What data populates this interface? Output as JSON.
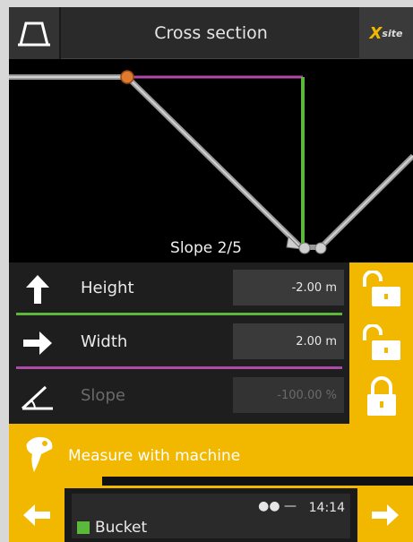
{
  "header": {
    "title": "Cross section",
    "logo_mark": "X",
    "logo_sub": "site",
    "profile_icon": "cross-section-profile-icon"
  },
  "canvas": {
    "slope_label": "Slope 2/5"
  },
  "rows": [
    {
      "label": "Height",
      "value": "-2.00 m",
      "icon": "arrow-up-icon",
      "line_color": "#5cb83b",
      "locked": false
    },
    {
      "label": "Width",
      "value": "2.00 m",
      "icon": "arrow-right-icon",
      "line_color": "#b04aa8",
      "locked": false
    },
    {
      "label": "Slope",
      "value": "-100.00 %",
      "icon": "angle-icon",
      "line_color": "",
      "locked": true
    }
  ],
  "measure": {
    "label": "Measure with machine",
    "icon": "bucket-tip-icon"
  },
  "footer": {
    "time": "14:14",
    "status_icons": "●● —",
    "tool_name": "Bucket",
    "tool_color": "#5cb83b"
  },
  "colors": {
    "accent": "#f2b800",
    "green_line": "#5cb83b",
    "purple_line": "#b04aa8",
    "point": "#e07a2e"
  }
}
